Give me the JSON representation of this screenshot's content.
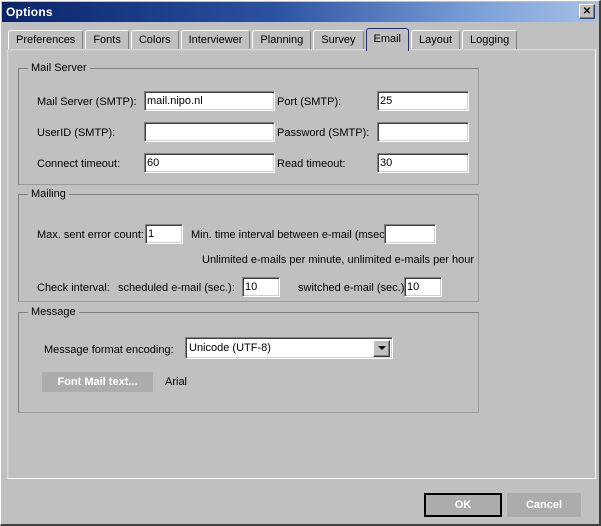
{
  "window": {
    "title": "Options",
    "close_label": "✕",
    "close_icon": "close-icon"
  },
  "tabs": [
    {
      "label": "Preferences",
      "selected": false
    },
    {
      "label": "Fonts",
      "selected": false
    },
    {
      "label": "Colors",
      "selected": false
    },
    {
      "label": "Interviewer",
      "selected": false
    },
    {
      "label": "Planning",
      "selected": false
    },
    {
      "label": "Survey",
      "selected": false
    },
    {
      "label": "Email",
      "selected": true
    },
    {
      "label": "Layout",
      "selected": false
    },
    {
      "label": "Logging",
      "selected": false
    }
  ],
  "mail_server": {
    "title": "Mail Server",
    "smtp_server_label": "Mail Server (SMTP):",
    "smtp_server_value": "mail.nipo.nl",
    "port_label": "Port (SMTP):",
    "port_value": "25",
    "userid_label": "UserID (SMTP):",
    "userid_value": "",
    "password_label": "Password (SMTP):",
    "password_value": "",
    "connect_timeout_label": "Connect timeout:",
    "connect_timeout_value": "60",
    "read_timeout_label": "Read timeout:",
    "read_timeout_value": "30"
  },
  "mailing": {
    "title": "Mailing",
    "max_error_label": "Max. sent error count:",
    "max_error_value": "1",
    "min_interval_label": "Min. time interval between e-mail (msec):",
    "min_interval_value": "",
    "rate_note": "Unlimited e-mails per minute, unlimited e-mails per hour",
    "check_interval_label": "Check interval:",
    "scheduled_label": "scheduled e-mail (sec.):",
    "scheduled_value": "10",
    "switched_label": "switched e-mail (sec.):",
    "switched_value": "10"
  },
  "message": {
    "title": "Message",
    "encoding_label": "Message format encoding:",
    "encoding_value": "Unicode (UTF-8)",
    "dropdown_icon": "chevron-down-icon",
    "font_button_label": "Font Mail text...",
    "font_name": "Arial"
  },
  "footer": {
    "ok_label": "OK",
    "cancel_label": "Cancel"
  },
  "colors": {
    "dialog_face": "#c0c0c0",
    "title_gradient_start": "#0a246a",
    "title_gradient_end": "#a6c0e8",
    "selected_tab_outline": "#2222aa",
    "flat_button_face": "#acacac",
    "flat_button_text": "#ffffff",
    "field_background": "#ffffff"
  }
}
